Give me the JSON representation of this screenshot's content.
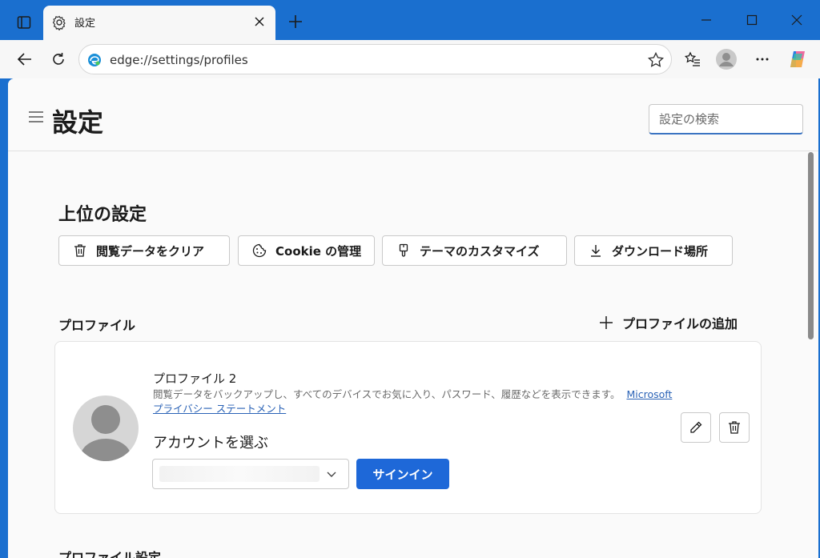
{
  "tab": {
    "title": "設定",
    "icon": "gear-icon"
  },
  "window": {
    "new_tab_icon": "plus-icon",
    "minimize_icon": "minimize-icon",
    "maximize_icon": "maximize-icon",
    "close_icon": "close-icon"
  },
  "toolbar": {
    "url": "edge://settings/profiles"
  },
  "header": {
    "title": "設定",
    "search_placeholder": "設定の検索"
  },
  "top_settings": {
    "title": "上位の設定",
    "buttons": [
      {
        "label": "閲覧データをクリア",
        "icon": "trash-icon"
      },
      {
        "label": "Cookie の管理",
        "icon": "cookie-icon"
      },
      {
        "label": "テーマのカスタマイズ",
        "icon": "brush-icon"
      },
      {
        "label": "ダウンロード場所",
        "icon": "download-icon"
      }
    ]
  },
  "profiles": {
    "heading": "プロファイル",
    "add_label": "プロファイルの追加",
    "card": {
      "name": "プロファイル 2",
      "description": "閲覧データをバックアップし、すべてのデバイスでお気に入り、パスワード、履歴などを表示できます。",
      "privacy_link": "Microsoft プライバシー ステートメント",
      "choose_account_label": "アカウントを選ぶ",
      "signin_label": "サインイン"
    }
  },
  "next_section_heading": "プロファイル設定",
  "colors": {
    "accent": "#1e68d8",
    "titlebar": "#1a6fcf"
  }
}
